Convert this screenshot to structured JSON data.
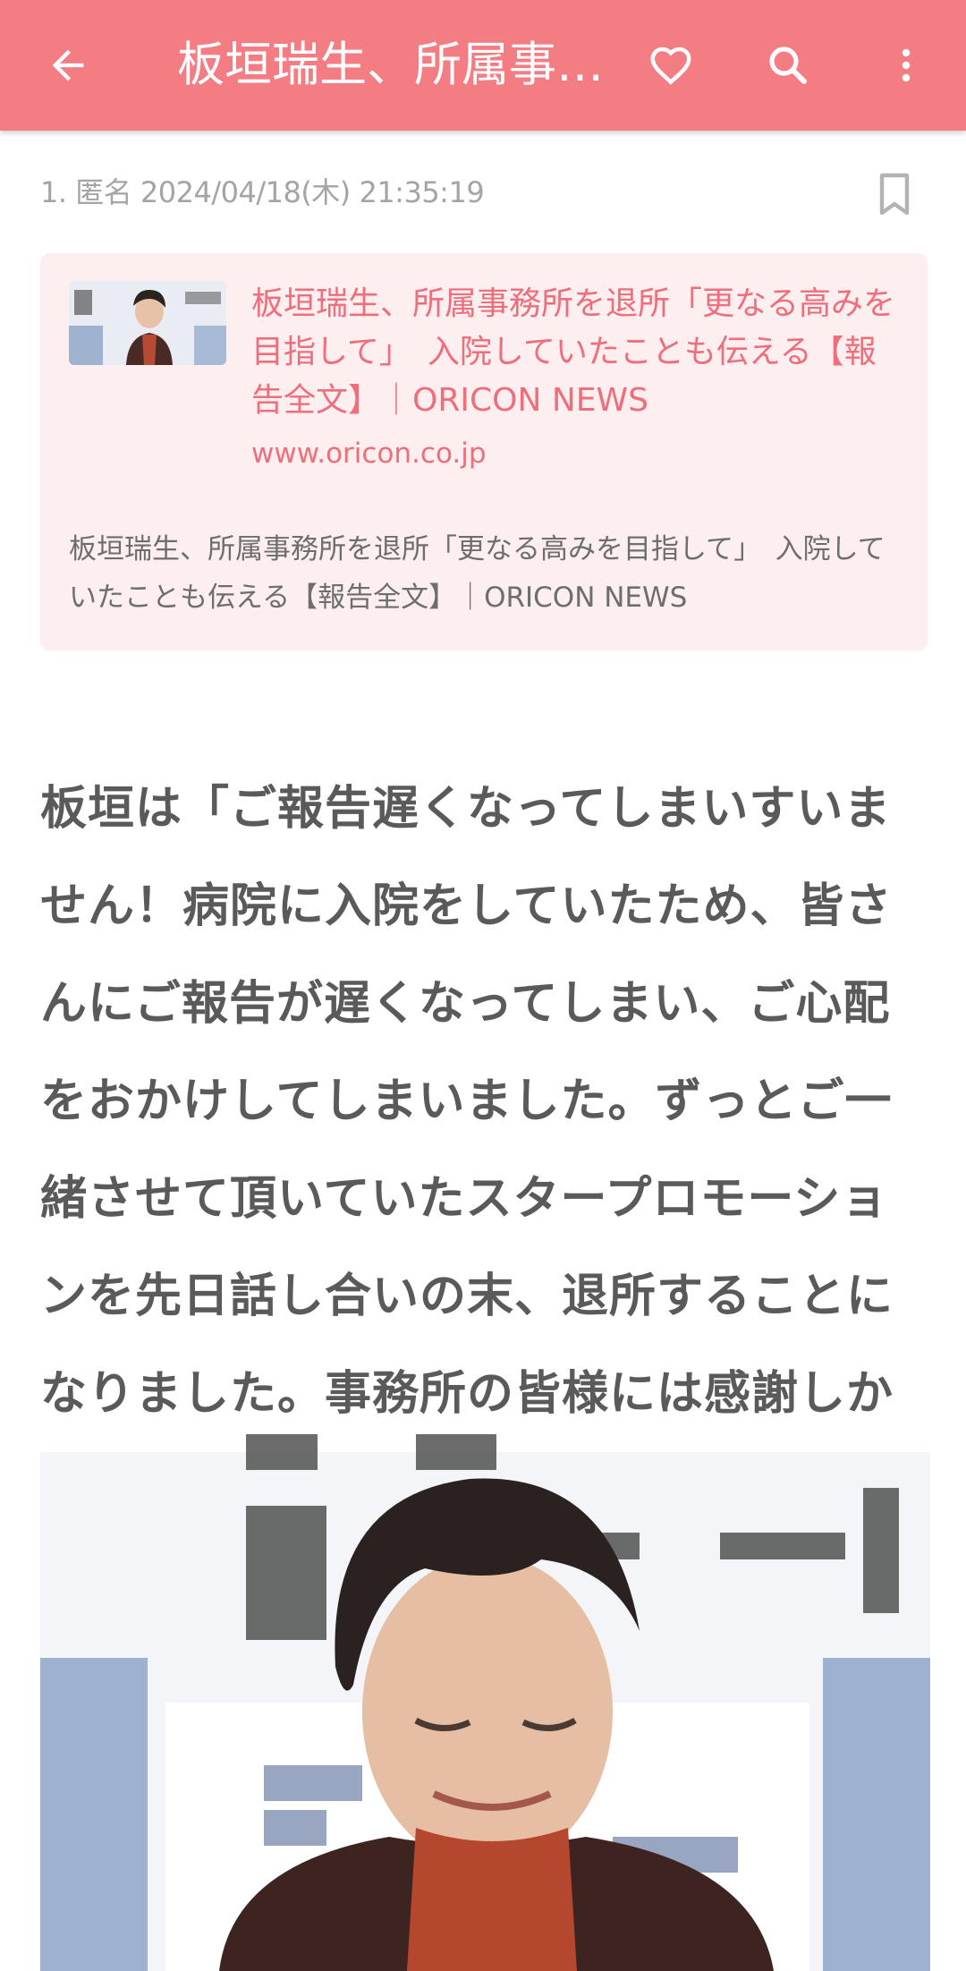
{
  "appbar": {
    "title": "板垣瑞生、所属事務所を退所「更なる高みを目指して」 入院していたことも伝える【報告全文】｜ORICON NEWS",
    "icons": [
      "arrow-back-icon",
      "heart-icon",
      "search-icon",
      "more-vert-icon"
    ]
  },
  "post": {
    "meta": "1. 匿名 2024/04/18(木) 21:35:19",
    "link_card": {
      "title": "板垣瑞生、所属事務所を退所「更なる高みを目指して」　入院していたことも伝える【報告全文】｜ORICON NEWS",
      "domain": "www.oricon.co.jp",
      "description": "板垣瑞生、所属事務所を退所「更なる高みを目指して」　入院していたことも伝える【報告全文】｜ORICON NEWS"
    },
    "body": "板垣は「ご報告遅くなってしまいすいません！病院に入院をしていたため、皆さんにご報告が遅くなってしまい、ご心配をおかけしてしまいました。ずっとご一緒させて頂いていたスタープロモーションを先日話し合いの末、退所することになりました。事務所の皆様には感謝しかございません」と伝えた。"
  },
  "colors": {
    "appbar": "#f47d84",
    "link": "#ee6f7b",
    "card_bg": "#fdeef0"
  }
}
